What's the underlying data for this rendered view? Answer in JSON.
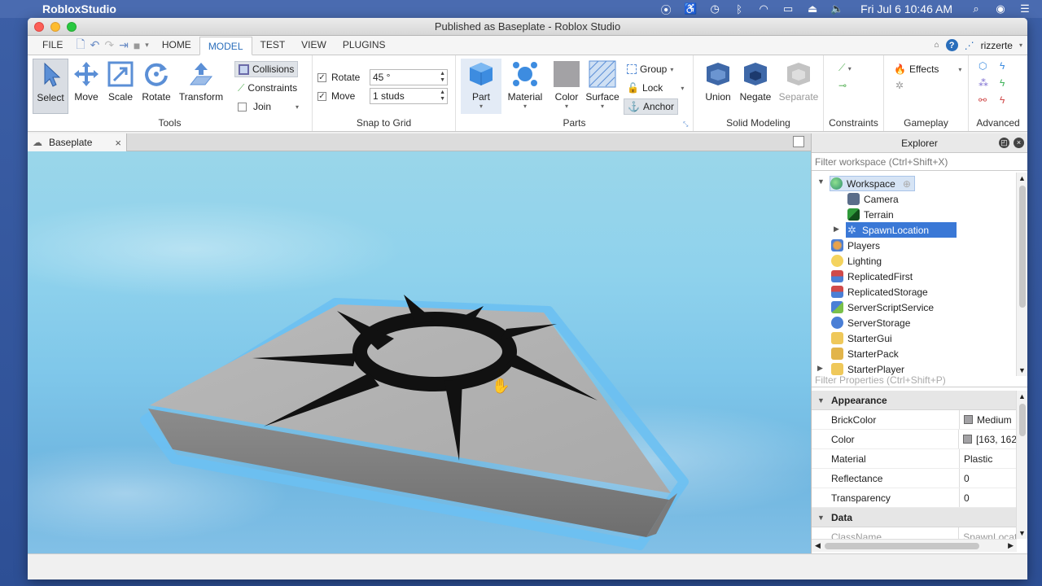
{
  "menubar": {
    "app_name": "RobloxStudio",
    "clock": "Fri Jul 6  10:46 AM"
  },
  "window": {
    "title": "Published as Baseplate - Roblox Studio"
  },
  "tabs": {
    "file": "FILE",
    "home": "HOME",
    "model": "MODEL",
    "test": "TEST",
    "view": "VIEW",
    "plugins": "PLUGINS",
    "active": "MODEL"
  },
  "user": {
    "name": "rizzerte"
  },
  "ribbon": {
    "tools": {
      "label": "Tools",
      "select": "Select",
      "move": "Move",
      "scale": "Scale",
      "rotate": "Rotate",
      "transform": "Transform",
      "collisions": "Collisions",
      "constraints": "Constraints",
      "join": "Join"
    },
    "snap": {
      "label": "Snap to Grid",
      "rotate_label": "Rotate",
      "rotate_value": "45 °",
      "move_label": "Move",
      "move_value": "1 studs",
      "rotate_checked": true,
      "move_checked": true
    },
    "parts": {
      "label": "Parts",
      "part": "Part",
      "material": "Material",
      "color": "Color",
      "surface": "Surface",
      "group": "Group",
      "lock": "Lock",
      "anchor": "Anchor"
    },
    "solid": {
      "label": "Solid Modeling",
      "union": "Union",
      "negate": "Negate",
      "separate": "Separate"
    },
    "constraints": {
      "label": "Constraints"
    },
    "gameplay": {
      "label": "Gameplay",
      "effects": "Effects"
    },
    "advanced": {
      "label": "Advanced"
    }
  },
  "doc_tab": {
    "name": "Baseplate"
  },
  "explorer": {
    "title": "Explorer",
    "filter_placeholder": "Filter workspace (Ctrl+Shift+X)",
    "items": [
      {
        "label": "Workspace"
      },
      {
        "label": "Camera"
      },
      {
        "label": "Terrain"
      },
      {
        "label": "SpawnLocation"
      },
      {
        "label": "Players"
      },
      {
        "label": "Lighting"
      },
      {
        "label": "ReplicatedFirst"
      },
      {
        "label": "ReplicatedStorage"
      },
      {
        "label": "ServerScriptService"
      },
      {
        "label": "ServerStorage"
      },
      {
        "label": "StarterGui"
      },
      {
        "label": "StarterPack"
      },
      {
        "label": "StarterPlayer"
      }
    ]
  },
  "properties": {
    "filter_placeholder": "Filter Properties (Ctrl+Shift+P)",
    "sections": {
      "appearance": "Appearance",
      "data": "Data"
    },
    "rows": [
      {
        "key": "BrickColor",
        "value": "Medium"
      },
      {
        "key": "Color",
        "value": "[163, 162"
      },
      {
        "key": "Material",
        "value": "Plastic"
      },
      {
        "key": "Reflectance",
        "value": "0"
      },
      {
        "key": "Transparency",
        "value": "0"
      }
    ],
    "data_row": {
      "key": "ClassName",
      "value": "SpawnLocat"
    }
  },
  "colors": {
    "accent": "#2a6ebb",
    "selection": "#3a78d6",
    "swatch": "#a3a2a5",
    "sky": "#8fd2ec",
    "selection_outline": "#6cc0f2"
  }
}
